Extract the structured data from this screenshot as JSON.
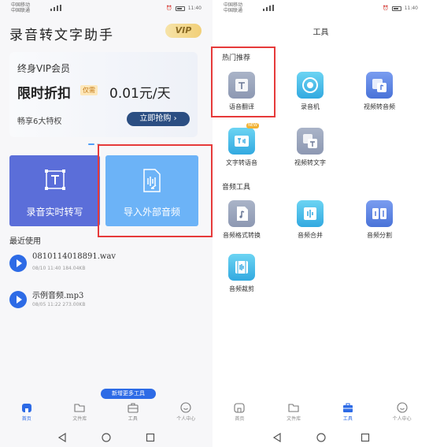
{
  "status_bar": {
    "carrier1": "中国移动",
    "carrier2": "中国联通",
    "net": "4G",
    "time": "11:40"
  },
  "home": {
    "app_title": "录音转文字助手",
    "vip_badge": "VIP",
    "vip_card": {
      "member_title": "终身VIP会员",
      "promo": "限时折扣",
      "tag": "仅需",
      "price": "0.01元/天",
      "benefits": "畅享6大特权",
      "buy_button": "立即抢购"
    },
    "realtime_card_label": "录音实时转写",
    "import_card_label": "导入外部音频",
    "recent_label": "最近使用",
    "recent_files": [
      {
        "name": "0810114018891.wav",
        "meta": "08/10 11:40   184.04KB"
      },
      {
        "name": "示例音频.mp3",
        "meta": "08/05 11:22   273.00KB"
      }
    ],
    "more_tools_tip": "新增更多工具"
  },
  "tools_page": {
    "title": "工具",
    "hot_section": "热门推荐",
    "audio_section": "音频工具",
    "hot_tools": [
      {
        "label": "语音翻译",
        "icon": "translate-icon"
      },
      {
        "label": "录音机",
        "icon": "recorder-icon"
      },
      {
        "label": "视频转音频",
        "icon": "video-to-audio-icon"
      },
      {
        "label": "文字转语音",
        "icon": "text-to-speech-icon",
        "badge": "NEW"
      },
      {
        "label": "视频转文字",
        "icon": "video-to-text-icon"
      }
    ],
    "audio_tools": [
      {
        "label": "音频格式转换",
        "icon": "audio-convert-icon"
      },
      {
        "label": "音频合并",
        "icon": "audio-merge-icon"
      },
      {
        "label": "音频分割",
        "icon": "audio-split-icon"
      },
      {
        "label": "音频裁剪",
        "icon": "audio-trim-icon"
      }
    ]
  },
  "nav_left": [
    {
      "label": "首页",
      "icon": "home-icon",
      "active": true
    },
    {
      "label": "文件库",
      "icon": "folder-icon"
    },
    {
      "label": "工具",
      "icon": "toolbox-icon"
    },
    {
      "label": "个人中心",
      "icon": "profile-icon"
    }
  ],
  "nav_right": [
    {
      "label": "首页",
      "icon": "home-icon"
    },
    {
      "label": "文件库",
      "icon": "folder-icon"
    },
    {
      "label": "工具",
      "icon": "toolbox-icon",
      "active": true
    },
    {
      "label": "个人中心",
      "icon": "profile-icon"
    }
  ],
  "colors": {
    "accent": "#2d6be6",
    "realtime_card": "#5b6ed9",
    "import_card": "#6cb3f7",
    "highlight": "#e63a3a"
  }
}
